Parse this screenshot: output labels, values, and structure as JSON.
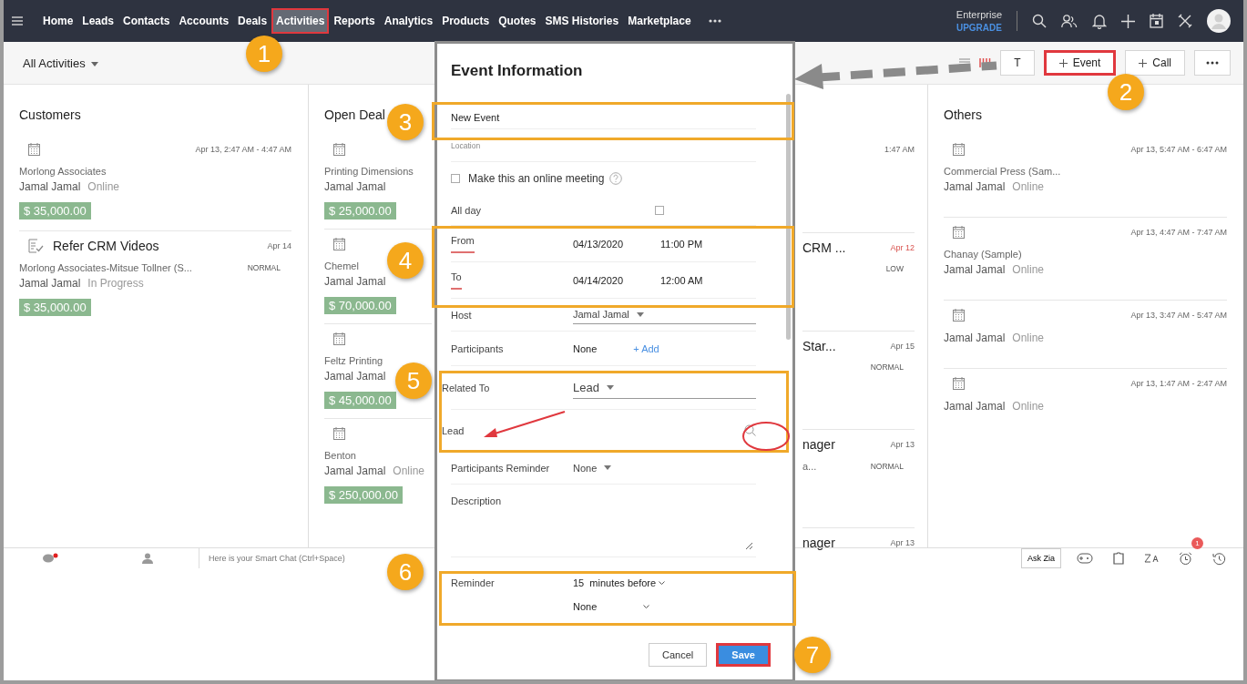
{
  "nav": {
    "items": [
      {
        "label": "Home",
        "selected": false,
        "highlighted": false
      },
      {
        "label": "Leads",
        "selected": false,
        "highlighted": false
      },
      {
        "label": "Contacts",
        "selected": false,
        "highlighted": false
      },
      {
        "label": "Accounts",
        "selected": false,
        "highlighted": false
      },
      {
        "label": "Deals",
        "selected": false,
        "highlighted": false
      },
      {
        "label": "Activities",
        "selected": true,
        "highlighted": true
      },
      {
        "label": "Reports",
        "selected": false,
        "highlighted": false
      },
      {
        "label": "Analytics",
        "selected": false,
        "highlighted": false
      },
      {
        "label": "Products",
        "selected": false,
        "highlighted": false
      },
      {
        "label": "Quotes",
        "selected": false,
        "highlighted": false
      },
      {
        "label": "SMS Histories",
        "selected": false,
        "highlighted": false
      },
      {
        "label": "Marketplace",
        "selected": false,
        "highlighted": false
      }
    ],
    "edition": "Enterprise",
    "upgrade": "UPGRADE"
  },
  "toolbar": {
    "view": "All Activities",
    "buttons": [
      {
        "label": "T",
        "highlighted": false
      },
      {
        "label": "Event",
        "highlighted": true
      },
      {
        "label": "Call",
        "highlighted": false
      }
    ]
  },
  "columns": [
    {
      "title": "Customers",
      "cards": [
        {
          "kind": "event",
          "time": "Apr 13, 2:47 AM - 4:47 AM",
          "account": "Morlong Associates",
          "owner": "Jamal Jamal",
          "status": "Online",
          "amount": "$ 35,000.00"
        },
        {
          "kind": "task",
          "title": "Refer CRM Videos",
          "time": "Apr 14",
          "overdue": false,
          "account": "Morlong Associates-Mitsue Tollner (S...",
          "priority": "NORMAL",
          "owner": "Jamal Jamal",
          "status": "In Progress",
          "amount": "$ 35,000.00"
        }
      ]
    },
    {
      "title": "Open Deal",
      "cards": [
        {
          "kind": "event",
          "account": "Printing Dimensions",
          "owner": "Jamal Jamal",
          "amount": "$ 25,000.00"
        },
        {
          "kind": "event",
          "account": "Chemel",
          "owner": "Jamal Jamal",
          "amount": "$ 70,000.00"
        },
        {
          "kind": "event",
          "account": "Feltz Printing",
          "owner": "Jamal Jamal",
          "amount": "$ 45,000.00"
        },
        {
          "kind": "event",
          "account": "Benton",
          "owner": "Jamal Jamal",
          "status": "Online",
          "amount": "$ 250,000.00"
        }
      ]
    },
    {
      "cards": [
        {
          "time": "1:47 AM"
        },
        {
          "title": "CRM ...",
          "time": "Apr 12",
          "overdue": true,
          "priority": "LOW"
        },
        {
          "title": "Star...",
          "time": "Apr 15",
          "overdue": false,
          "priority": "NORMAL"
        },
        {
          "title": "nager",
          "time": "Apr 13",
          "overdue": false,
          "account": "a...",
          "priority": "NORMAL"
        },
        {
          "title": "nager",
          "time": "Apr 13",
          "overdue": false
        }
      ]
    },
    {
      "title": "Others",
      "cards": [
        {
          "kind": "event",
          "time": "Apr 13, 5:47 AM - 6:47 AM",
          "account": "Commercial Press (Sam...",
          "owner": "Jamal Jamal",
          "status": "Online"
        },
        {
          "kind": "event",
          "time": "Apr 13, 4:47 AM - 7:47 AM",
          "account": "Chanay (Sample)",
          "owner": "Jamal Jamal",
          "status": "Online"
        },
        {
          "kind": "event",
          "time": "Apr 13, 3:47 AM - 5:47 AM",
          "owner": "Jamal Jamal",
          "status": "Online"
        },
        {
          "kind": "event",
          "time": "Apr 13, 1:47 AM - 2:47 AM",
          "owner": "Jamal Jamal",
          "status": "Online"
        }
      ]
    }
  ],
  "modal": {
    "title": "Event Information",
    "fields": [
      {
        "kind": "text",
        "value": "New Event"
      },
      {
        "kind": "text",
        "placeholder": "Location"
      },
      {
        "kind": "check",
        "label": "Make this an online meeting",
        "checked": false
      },
      {
        "kind": "checkrow",
        "label": "All day",
        "checked": false
      },
      {
        "kind": "datetime",
        "label": "From",
        "date": "04/13/2020",
        "time": "11:00 PM"
      },
      {
        "kind": "datetime",
        "label": "To",
        "date": "04/14/2020",
        "time": "12:00 AM"
      },
      {
        "kind": "select",
        "label": "Host",
        "value": "Jamal Jamal"
      },
      {
        "kind": "participants",
        "label": "Participants",
        "value": "None",
        "action": "+ Add"
      },
      {
        "kind": "select",
        "label": "Related To",
        "value": "Lead"
      },
      {
        "kind": "lookup",
        "label": "Lead"
      },
      {
        "kind": "select",
        "label": "Participants Reminder",
        "value": "None"
      },
      {
        "kind": "textarea",
        "label": "Description"
      },
      {
        "kind": "reminder",
        "label": "Reminder",
        "value": "15",
        "unit": "minutes before",
        "second": "None"
      }
    ],
    "buttons": [
      {
        "label": "Cancel",
        "primary": false,
        "highlighted": false
      },
      {
        "label": "Save",
        "primary": true,
        "highlighted": true
      }
    ]
  },
  "footer": {
    "chat_placeholder": "Here is your Smart Chat (Ctrl+Space)",
    "ask": "Ask Zia",
    "alarm_badge": "1"
  },
  "steps": [
    "1",
    "2",
    "3",
    "4",
    "5",
    "6",
    "7"
  ]
}
